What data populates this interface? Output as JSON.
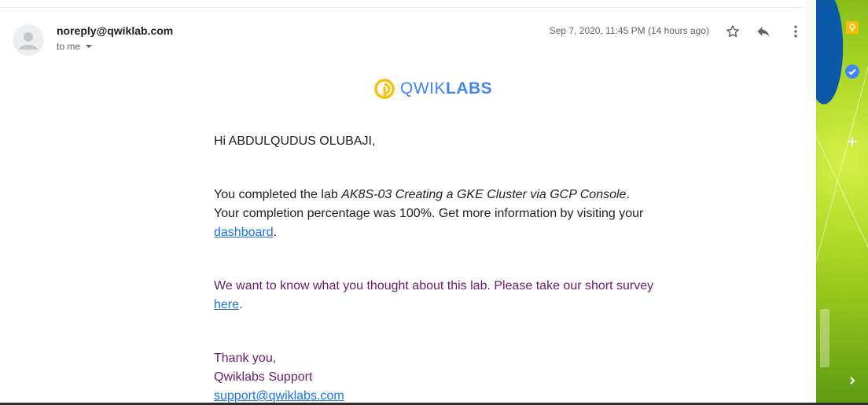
{
  "email": {
    "sender": "noreply@qwiklab.com",
    "recipient": "to me",
    "timestamp": "Sep 7, 2020, 11:45 PM (14 hours ago)",
    "actions": {
      "star_icon": "star-icon",
      "reply_icon": "reply-icon",
      "more_icon": "more-vert-icon"
    }
  },
  "logo": {
    "text_light": "QWIK",
    "text_bold": "LABS",
    "color": "#4285f4",
    "mark_color": "#f4c20d"
  },
  "body": {
    "greeting": "Hi ABDULQUDUS OLUBAJI,",
    "p1_before": "You completed the lab ",
    "p1_lab": "AK8S-03 Creating a GKE Cluster via GCP Console",
    "p1_after": ". Your completion percentage was 100%. Get more information by visiting your ",
    "p1_link": "dashboard",
    "p1_end": ".",
    "p2_before": "We want to know what you thought about this lab. Please take our short survey ",
    "p2_link": "here",
    "p2_end": ".",
    "thanks": "Thank you,",
    "team": "Qwiklabs Support",
    "support_email": "support@qwiklabs.com"
  },
  "side_panel": {
    "icons": [
      "keep-icon",
      "tasks-icon",
      "add-icon",
      "chevron-right-icon"
    ]
  },
  "colors": {
    "link": "#1a73e8",
    "quoted_text": "#6a1b6a",
    "text": "#202124",
    "muted": "#5f6368"
  }
}
